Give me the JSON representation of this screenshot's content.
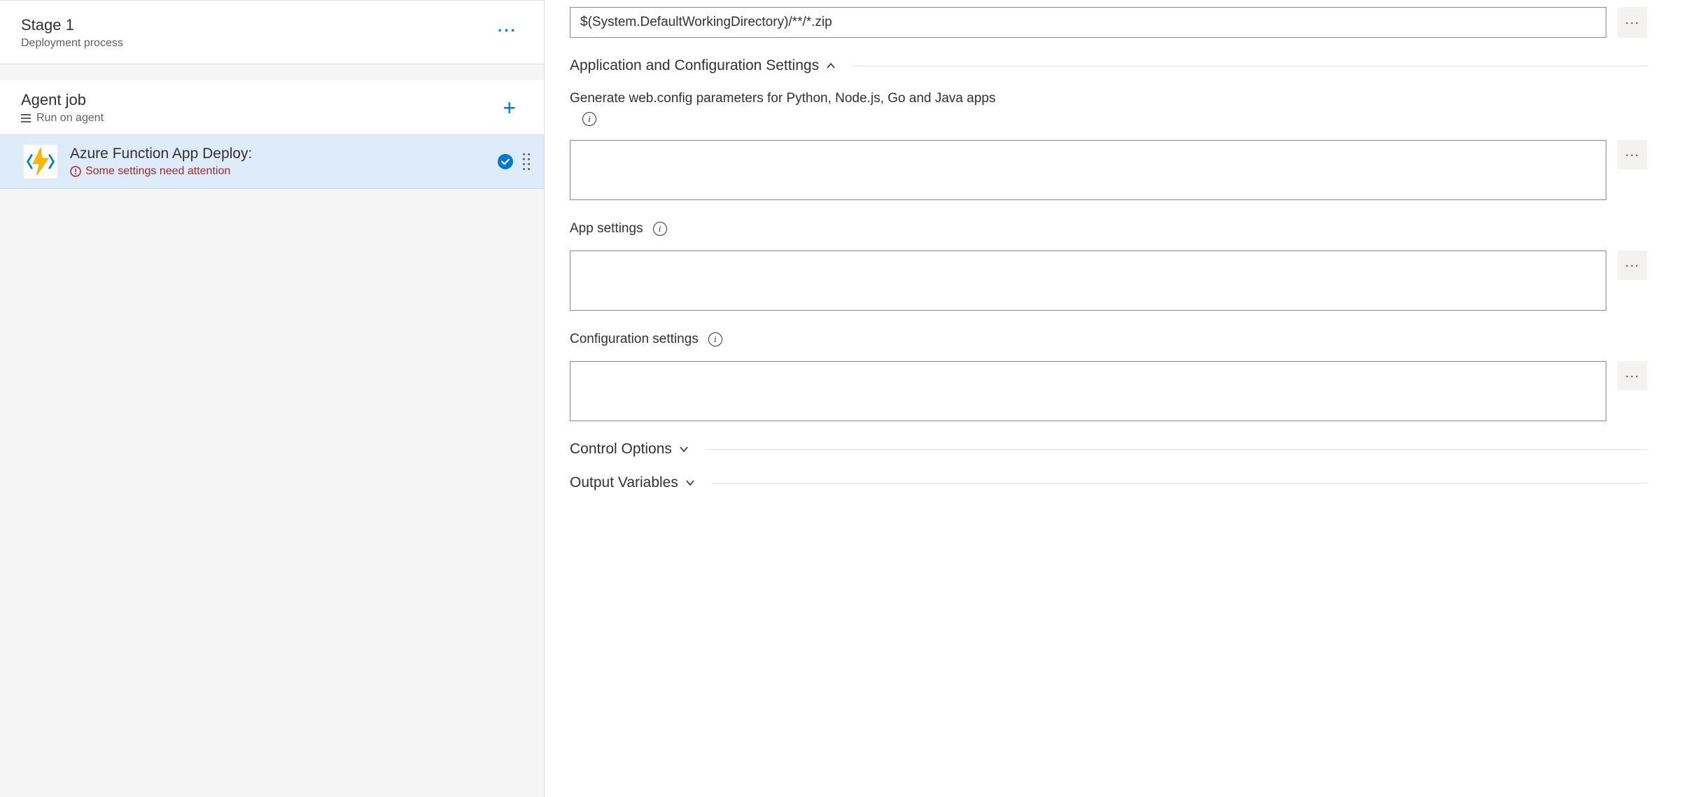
{
  "stage": {
    "title": "Stage 1",
    "subtitle": "Deployment process"
  },
  "job": {
    "title": "Agent job",
    "subtitle": "Run on agent"
  },
  "task": {
    "title": "Azure Function App Deploy:",
    "warning": "Some settings need attention"
  },
  "rightPanel": {
    "packagePath": "$(System.DefaultWorkingDirectory)/**/*.zip",
    "sections": {
      "appConfig": "Application and Configuration Settings",
      "controlOptions": "Control Options",
      "outputVariables": "Output Variables"
    },
    "fields": {
      "webConfig": "Generate web.config parameters for Python, Node.js, Go and Java apps",
      "appSettings": "App settings",
      "configSettings": "Configuration settings"
    },
    "values": {
      "webConfig": "",
      "appSettings": "",
      "configSettings": ""
    }
  }
}
